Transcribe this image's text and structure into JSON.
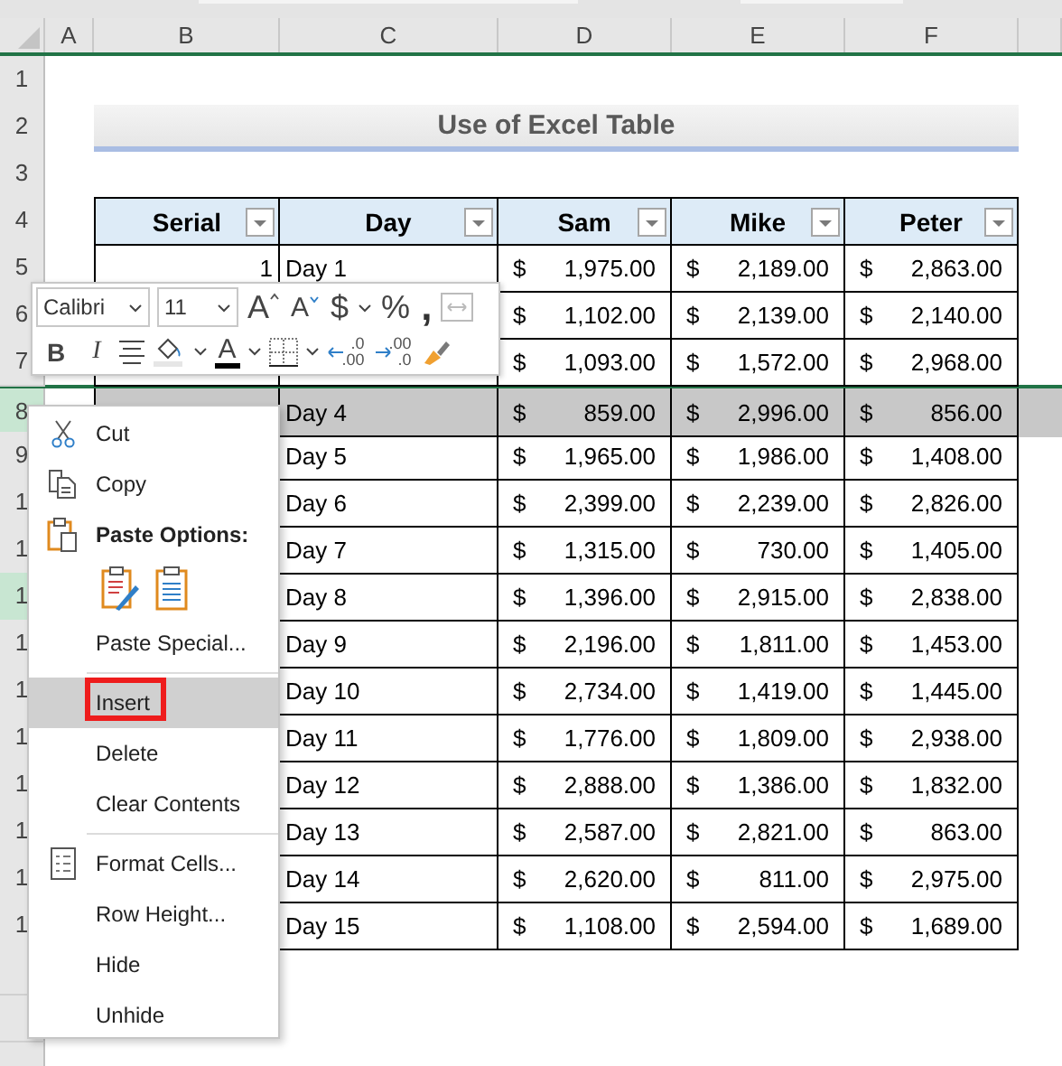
{
  "columns": [
    "A",
    "B",
    "C",
    "D",
    "E",
    "F"
  ],
  "row_headers": [
    {
      "label": "1",
      "selected": false
    },
    {
      "label": "2",
      "selected": false
    },
    {
      "label": "3",
      "selected": false
    },
    {
      "label": "4",
      "selected": false
    },
    {
      "label": "5",
      "selected": false
    },
    {
      "label": "6",
      "selected": false
    },
    {
      "label": "7",
      "selected": false
    },
    {
      "label": "8",
      "selected": true
    },
    {
      "label": "9",
      "selected": false
    },
    {
      "label": "1",
      "selected": false
    },
    {
      "label": "1",
      "selected": false
    },
    {
      "label": "1",
      "selected": true
    },
    {
      "label": "1",
      "selected": false
    },
    {
      "label": "1",
      "selected": false
    },
    {
      "label": "1",
      "selected": false
    },
    {
      "label": "1",
      "selected": false
    },
    {
      "label": "1",
      "selected": false
    },
    {
      "label": "1",
      "selected": false
    },
    {
      "label": "1",
      "selected": false
    },
    {
      "selected": false
    },
    {
      "selected": false
    },
    {
      "selected": false
    }
  ],
  "title": "Use of Excel Table",
  "table": {
    "headers": [
      "Serial",
      "Day",
      "Sam",
      "Mike",
      "Peter"
    ],
    "rows": [
      {
        "serial": "1",
        "day": "Day 1",
        "selected": false,
        "amounts": [
          {
            "currency": "$",
            "value": "1,975.00"
          },
          {
            "currency": "$",
            "value": "2,189.00"
          },
          {
            "currency": "$",
            "value": "2,863.00"
          }
        ]
      },
      {
        "selected": false,
        "amounts": [
          {
            "currency": "$",
            "value": "1,102.00"
          },
          {
            "currency": "$",
            "value": "2,139.00"
          },
          {
            "currency": "$",
            "value": "2,140.00"
          }
        ]
      },
      {
        "selected": false,
        "amounts": [
          {
            "currency": "$",
            "value": "1,093.00"
          },
          {
            "currency": "$",
            "value": "1,572.00"
          },
          {
            "currency": "$",
            "value": "2,968.00"
          }
        ]
      },
      {
        "day": "Day 4",
        "selected": true,
        "amounts": [
          {
            "currency": "$",
            "value": "859.00"
          },
          {
            "currency": "$",
            "value": "2,996.00"
          },
          {
            "currency": "$",
            "value": "856.00"
          }
        ]
      },
      {
        "day": "Day 5",
        "selected": false,
        "amounts": [
          {
            "currency": "$",
            "value": "1,965.00"
          },
          {
            "currency": "$",
            "value": "1,986.00"
          },
          {
            "currency": "$",
            "value": "1,408.00"
          }
        ]
      },
      {
        "day": "Day 6",
        "selected": false,
        "amounts": [
          {
            "currency": "$",
            "value": "2,399.00"
          },
          {
            "currency": "$",
            "value": "2,239.00"
          },
          {
            "currency": "$",
            "value": "2,826.00"
          }
        ]
      },
      {
        "day": "Day 7",
        "selected": false,
        "amounts": [
          {
            "currency": "$",
            "value": "1,315.00"
          },
          {
            "currency": "$",
            "value": "730.00"
          },
          {
            "currency": "$",
            "value": "1,405.00"
          }
        ]
      },
      {
        "day": "Day 8",
        "selected": false,
        "amounts": [
          {
            "currency": "$",
            "value": "1,396.00"
          },
          {
            "currency": "$",
            "value": "2,915.00"
          },
          {
            "currency": "$",
            "value": "2,838.00"
          }
        ]
      },
      {
        "day": "Day 9",
        "selected": false,
        "amounts": [
          {
            "currency": "$",
            "value": "2,196.00"
          },
          {
            "currency": "$",
            "value": "1,811.00"
          },
          {
            "currency": "$",
            "value": "1,453.00"
          }
        ]
      },
      {
        "day": "Day 10",
        "selected": false,
        "amounts": [
          {
            "currency": "$",
            "value": "2,734.00"
          },
          {
            "currency": "$",
            "value": "1,419.00"
          },
          {
            "currency": "$",
            "value": "1,445.00"
          }
        ]
      },
      {
        "day": "Day 11",
        "selected": false,
        "amounts": [
          {
            "currency": "$",
            "value": "1,776.00"
          },
          {
            "currency": "$",
            "value": "1,809.00"
          },
          {
            "currency": "$",
            "value": "2,938.00"
          }
        ]
      },
      {
        "day": "Day 12",
        "selected": false,
        "amounts": [
          {
            "currency": "$",
            "value": "2,888.00"
          },
          {
            "currency": "$",
            "value": "1,386.00"
          },
          {
            "currency": "$",
            "value": "1,832.00"
          }
        ]
      },
      {
        "day": "Day 13",
        "selected": false,
        "amounts": [
          {
            "currency": "$",
            "value": "2,587.00"
          },
          {
            "currency": "$",
            "value": "2,821.00"
          },
          {
            "currency": "$",
            "value": "863.00"
          }
        ]
      },
      {
        "day": "Day 14",
        "selected": false,
        "amounts": [
          {
            "currency": "$",
            "value": "2,620.00"
          },
          {
            "currency": "$",
            "value": "811.00"
          },
          {
            "currency": "$",
            "value": "2,975.00"
          }
        ]
      },
      {
        "day": "Day 15",
        "selected": false,
        "amounts": [
          {
            "currency": "$",
            "value": "1,108.00"
          },
          {
            "currency": "$",
            "value": "2,594.00"
          },
          {
            "currency": "$",
            "value": "1,689.00"
          }
        ]
      }
    ]
  },
  "mini_toolbar": {
    "font": "Calibri",
    "size": "11",
    "row1": [
      {
        "kind": "grow",
        "label": "A"
      },
      {
        "kind": "shrink",
        "label": "A"
      },
      {
        "kind": "glyph",
        "label": "$"
      },
      {
        "kind": "caret"
      },
      {
        "kind": "glyph",
        "label": "%"
      },
      {
        "kind": "comma",
        "label": ","
      },
      {
        "kind": "merge"
      }
    ],
    "row2": [
      {
        "kind": "bold",
        "label": "B"
      },
      {
        "kind": "italic",
        "label": "I"
      },
      {
        "kind": "align"
      },
      {
        "kind": "fill"
      },
      {
        "kind": "caret"
      },
      {
        "kind": "fontcolor",
        "label": "A"
      },
      {
        "kind": "caret"
      },
      {
        "kind": "borders"
      },
      {
        "kind": "caret"
      },
      {
        "kind": "moredecimals",
        "top": ".0",
        "bottom": ".00"
      },
      {
        "kind": "lessdecimals",
        "top": ".00",
        "bottom": ".0"
      },
      {
        "kind": "painter"
      }
    ]
  },
  "context_menu": [
    {
      "kind": "command",
      "label": "Cut",
      "selected": false
    },
    {
      "kind": "command",
      "label": "Copy",
      "selected": false
    },
    {
      "kind": "heading",
      "label": "Paste Options:"
    },
    {
      "kind": "paste_row"
    },
    {
      "kind": "command",
      "label": "Paste Special...",
      "selected": false,
      "separator_after": true
    },
    {
      "kind": "command",
      "label": "Insert",
      "selected": true,
      "marked": true
    },
    {
      "kind": "command",
      "label": "Delete",
      "selected": false
    },
    {
      "kind": "command",
      "label": "Clear Contents",
      "selected": false,
      "separator_after": true
    },
    {
      "kind": "command",
      "label": "Format Cells...",
      "selected": false
    },
    {
      "kind": "command",
      "label": "Row Height...",
      "selected": false
    },
    {
      "kind": "command",
      "label": "Hide",
      "selected": false
    },
    {
      "kind": "command",
      "label": "Unhide",
      "selected": false
    }
  ]
}
